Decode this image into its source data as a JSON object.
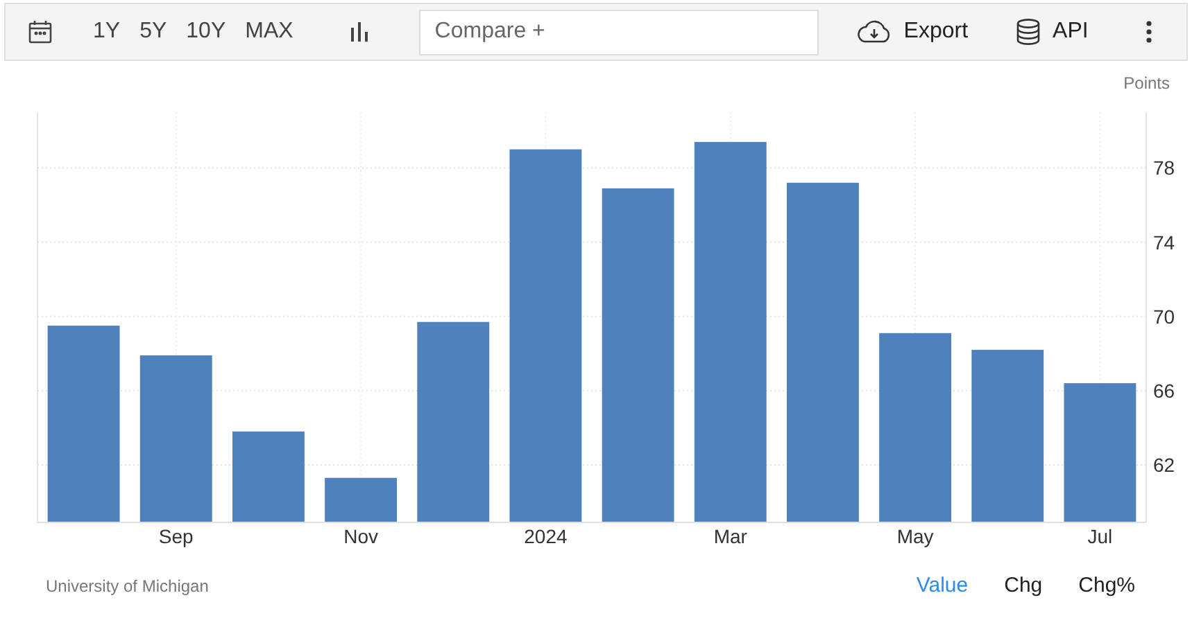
{
  "toolbar": {
    "ranges": [
      {
        "label": "1Y",
        "selected": false
      },
      {
        "label": "5Y",
        "selected": false
      },
      {
        "label": "10Y",
        "selected": false
      },
      {
        "label": "MAX",
        "selected": false
      }
    ],
    "compare": {
      "placeholder": "Compare +"
    },
    "export": "Export",
    "api": "API"
  },
  "chart": {
    "chart_data": {
      "type": "bar",
      "ylabel": "Points",
      "grid": true,
      "categories": [
        null,
        "Sep",
        null,
        "Nov",
        null,
        "2024",
        null,
        "Mar",
        null,
        "May",
        null,
        "Jul"
      ],
      "values": [
        69.5,
        67.9,
        63.8,
        61.3,
        69.7,
        79.0,
        76.9,
        79.4,
        77.2,
        69.1,
        68.2,
        66.4
      ],
      "ylim": [
        58.9,
        81
      ],
      "yticks": [
        62,
        66,
        70,
        74,
        78
      ]
    }
  },
  "footer": {
    "source": "University of Michigan",
    "views": [
      {
        "label": "Value",
        "selected": true
      },
      {
        "label": "Chg",
        "selected": false
      },
      {
        "label": "Chg%",
        "selected": false
      }
    ]
  }
}
